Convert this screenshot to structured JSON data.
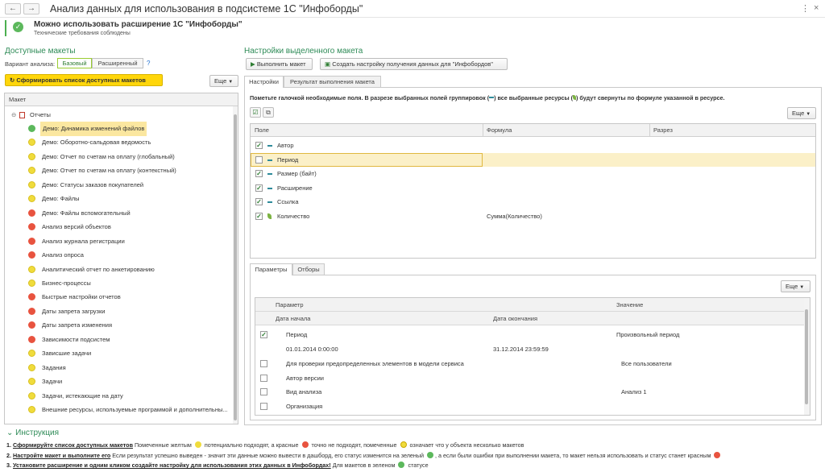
{
  "window": {
    "title": "Анализ данных для использования в подсистеме 1С \"Инфоборды\"",
    "back": "←",
    "forward": "→",
    "menu": "⋮",
    "close": "×"
  },
  "banner": {
    "title": "Можно использовать расширение 1С \"Инфоборды\"",
    "subtitle": "Технические требования соблюдены"
  },
  "left": {
    "section_title": "Доступные макеты",
    "variant_label": "Вариант анализа:",
    "variant_options": [
      "Базовый",
      "Расширенный"
    ],
    "help": "?",
    "generate_button": "Сформировать список доступных макетов",
    "more_button": "Еще",
    "column_header": "Макет",
    "root_label": "Отчеты",
    "items": [
      {
        "label": "Демо: Динамика изменений файлов",
        "status": "green"
      },
      {
        "label": "Демо: Оборотно-сальдовая ведомость",
        "status": "yellow"
      },
      {
        "label": "Демо: Отчет по счетам на оплату (глобальный)",
        "status": "yellow"
      },
      {
        "label": "Демо: Отчет по счетам на оплату (контекстный)",
        "status": "yellow"
      },
      {
        "label": "Демо: Статусы заказов покупателей",
        "status": "yellow"
      },
      {
        "label": "Демо: Файлы",
        "status": "yellow"
      },
      {
        "label": "Демо: Файлы вспомогательный",
        "status": "red"
      },
      {
        "label": "Анализ версий объектов",
        "status": "red"
      },
      {
        "label": "Анализ журнала регистрации",
        "status": "red"
      },
      {
        "label": "Анализ опроса",
        "status": "red"
      },
      {
        "label": "Аналитический отчет по анкетированию",
        "status": "yellow"
      },
      {
        "label": "Бизнес-процессы",
        "status": "yellow"
      },
      {
        "label": "Быстрые настройки отчетов",
        "status": "red"
      },
      {
        "label": "Даты запрета загрузки",
        "status": "red"
      },
      {
        "label": "Даты запрета изменения",
        "status": "red"
      },
      {
        "label": "Зависимости подсистем",
        "status": "red"
      },
      {
        "label": "Зависшие задачи",
        "status": "yellow"
      },
      {
        "label": "Задания",
        "status": "yellow"
      },
      {
        "label": "Задачи",
        "status": "yellow"
      },
      {
        "label": "Задачи, истекающие на дату",
        "status": "yellow"
      },
      {
        "label": "Внешние ресурсы, используемые программой и дополнительны...",
        "status": "yellow"
      }
    ]
  },
  "right": {
    "section_title": "Настройки выделенного макета",
    "run_button": "Выполнить макет",
    "create_button": "Создать настройку получения данных для \"Инфобордов\"",
    "tabs": [
      "Настройки",
      "Результат выполнения макета"
    ],
    "note_part1": "Пометьте галочкой необходимые поля. В разрезе выбранных полей группировок (",
    "note_part2": ") все выбранные ресурсы (",
    "note_part3": ") будут свернуты по формуле указанной в ресурсе.",
    "more_button": "Еще",
    "field_columns": [
      "Поле",
      "Формула",
      "Разрез"
    ],
    "fields": [
      {
        "name": "Автор",
        "checked": true,
        "kind": "group",
        "formula": ""
      },
      {
        "name": "Период",
        "checked": false,
        "kind": "group",
        "formula": ""
      },
      {
        "name": "Размер (байт)",
        "checked": true,
        "kind": "group",
        "formula": ""
      },
      {
        "name": "Расширение",
        "checked": true,
        "kind": "group",
        "formula": ""
      },
      {
        "name": "Ссылка",
        "checked": true,
        "kind": "group",
        "formula": ""
      },
      {
        "name": "Количество",
        "checked": true,
        "kind": "resource",
        "formula": "Сумма(Количество)"
      }
    ],
    "param_tabs": [
      "Параметры",
      "Отборы"
    ],
    "param_more_button": "Еще",
    "param_columns": {
      "param": "Параметр",
      "value": "Значение",
      "start": "Дата начала",
      "end": "Дата окончания"
    },
    "params": {
      "period_name": "Период",
      "period_value": "Произвольный период",
      "period_start": "01.01.2014 0:00:00",
      "period_end": "31.12.2014 23:59:59",
      "rows": [
        {
          "name": "Для проверки предопределенных элементов в модели сервиса",
          "value": "Все пользователи"
        },
        {
          "name": "Автор версии",
          "value": ""
        },
        {
          "name": "Вид анализа",
          "value": "Анализ 1"
        },
        {
          "name": "Организация",
          "value": ""
        }
      ]
    }
  },
  "instructions": {
    "title": "Инструкция",
    "line1_num": "1.",
    "line1_bold": "Сформируйте список доступных макетов",
    "line1_a": " Помеченные желтым ",
    "line1_b": " потенциально подходят, а красные ",
    "line1_c": " точно не подходят, помеченные ",
    "line1_d": " означает что у объекта несколько макетов",
    "line2_num": "2.",
    "line2_bold": "Настройте макет и выполните его",
    "line2_a": " Если результат успешно выведен - значит эти данные можно вывести в дашборд, его статус изменится на зеленый ",
    "line2_b": ", а если были ошибки при выполнении макета, то макет нельзя использовать и статус станет красным ",
    "line3_num": "3.",
    "line3_bold": "Установите расширение и одним кликом создайте настройку для использования этих данных в Инфобордах!",
    "line3_a": " Для макетов в зеленом ",
    "line3_b": " статусе"
  },
  "colors": {
    "accent": "#2e8b57",
    "yellow_button": "#ffd60a",
    "green": "#5cb85c",
    "yellow": "#f0dc3c",
    "red": "#e8533f"
  }
}
